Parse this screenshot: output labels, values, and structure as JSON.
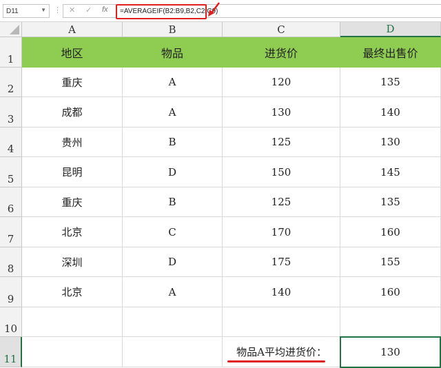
{
  "formula_bar": {
    "name_box": "D11",
    "cancel_icon": "✕",
    "enter_icon": "✓",
    "fx_label": "fx",
    "formula": "=AVERAGEIF(B2:B9,B2,C2:C9)"
  },
  "columns": [
    "A",
    "B",
    "C",
    "D"
  ],
  "rows": [
    "1",
    "2",
    "3",
    "4",
    "5",
    "6",
    "7",
    "8",
    "9",
    "10",
    "11"
  ],
  "table": {
    "headers": [
      "地区",
      "物品",
      "进货价",
      "最终出售价"
    ],
    "data": [
      [
        "重庆",
        "A",
        "120",
        "135"
      ],
      [
        "成都",
        "A",
        "130",
        "140"
      ],
      [
        "贵州",
        "B",
        "125",
        "130"
      ],
      [
        "昆明",
        "D",
        "150",
        "145"
      ],
      [
        "重庆",
        "B",
        "125",
        "135"
      ],
      [
        "北京",
        "C",
        "170",
        "160"
      ],
      [
        "深圳",
        "D",
        "175",
        "155"
      ],
      [
        "北京",
        "A",
        "140",
        "160"
      ]
    ]
  },
  "summary": {
    "label": "物品A平均进货价：",
    "value": "130"
  },
  "colors": {
    "header_green": "#8fcc52",
    "highlight_red": "#e02020",
    "select_green": "#217346"
  }
}
